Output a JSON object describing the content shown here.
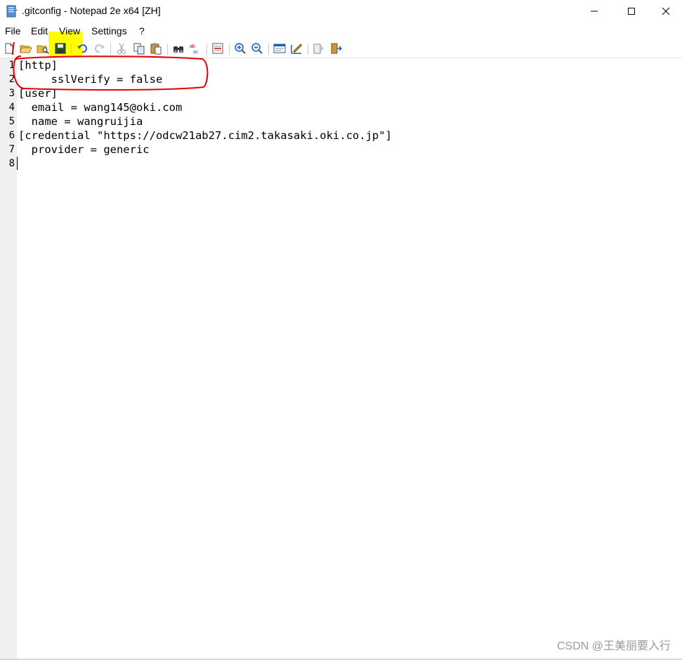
{
  "window": {
    "title": ".gitconfig - Notepad 2e x64 [ZH]"
  },
  "menu": {
    "items": [
      "File",
      "Edit",
      "View",
      "Settings",
      "?"
    ]
  },
  "toolbar": {
    "buttons": [
      "new-file",
      "open",
      "browse",
      "save",
      "undo",
      "redo",
      "cut",
      "copy",
      "paste",
      "find",
      "replace",
      "goto",
      "zoom-in",
      "zoom-out",
      "scheme",
      "customize",
      "open-new",
      "exit"
    ]
  },
  "editor": {
    "line_numbers": [
      "1",
      "2",
      "3",
      "4",
      "5",
      "6",
      "7",
      "8"
    ],
    "lines": [
      "[http]",
      "     sslVerify = false",
      "[user]",
      "  email = wang145@oki.com",
      "  name = wangruijia",
      "[credential \"https://odcw21ab27.cim2.takasaki.oki.co.jp\"]",
      "  provider = generic",
      ""
    ]
  },
  "watermark": "CSDN @王美丽要入行",
  "colors": {
    "annotation": "#e00000",
    "highlight": "#ffff00",
    "gutter": "#f0f0f0"
  }
}
